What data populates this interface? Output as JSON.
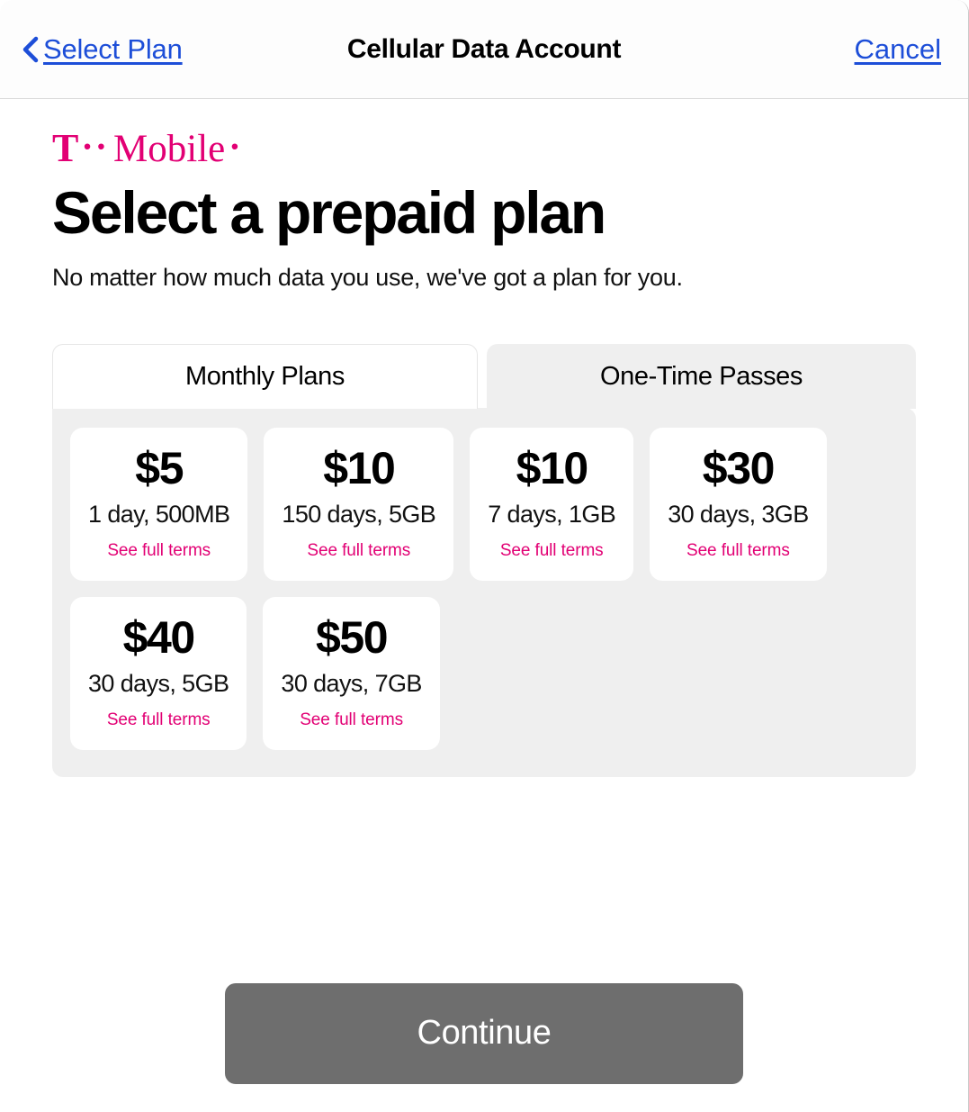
{
  "navbar": {
    "back_label": "Select Plan",
    "back_icon": "chevron-left-icon",
    "title": "Cellular Data Account",
    "cancel_label": "Cancel",
    "link_color": "#1d4ed8"
  },
  "brand": {
    "t_glyph": "T",
    "dots": "··",
    "word": "Mobile",
    "tail_dot": "·",
    "color": "#e20074",
    "name": "T-Mobile"
  },
  "page": {
    "title": "Select a prepaid plan",
    "subtitle": "No matter how much data you use, we've got a plan for you."
  },
  "tabs": [
    {
      "label": "Monthly Plans",
      "active": true
    },
    {
      "label": "One-Time Passes",
      "active": false
    }
  ],
  "plans": [
    {
      "price": "$5",
      "detail": "1 day, 500MB",
      "terms": "See full terms"
    },
    {
      "price": "$10",
      "detail": "150 days, 5GB",
      "terms": "See full terms"
    },
    {
      "price": "$10",
      "detail": "7 days, 1GB",
      "terms": "See full terms"
    },
    {
      "price": "$30",
      "detail": "30 days, 3GB",
      "terms": "See full terms"
    },
    {
      "price": "$40",
      "detail": "30 days, 5GB",
      "terms": "See full terms"
    },
    {
      "price": "$50",
      "detail": "30 days, 7GB",
      "terms": "See full terms"
    }
  ],
  "footer": {
    "continue_label": "Continue",
    "continue_enabled": false,
    "continue_color": "#6e6e6e"
  },
  "colors": {
    "accent_magenta": "#e20074",
    "link_blue": "#1d4ed8",
    "panel_gray": "#efefef",
    "button_gray": "#6e6e6e"
  }
}
